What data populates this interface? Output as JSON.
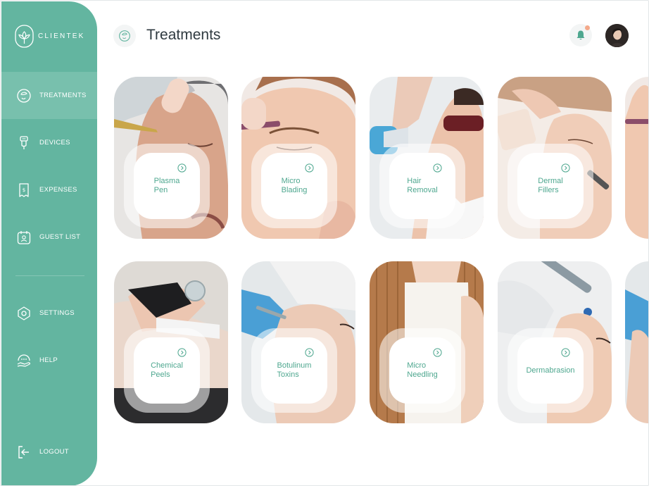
{
  "app": {
    "brand": "CLIENTEK"
  },
  "header": {
    "title": "Treatments"
  },
  "sidebar": {
    "items": [
      {
        "label": "TREATMENTS",
        "icon": "face-icon",
        "active": true
      },
      {
        "label": "DEVICES",
        "icon": "device-icon",
        "active": false
      },
      {
        "label": "EXPENSES",
        "icon": "receipt-icon",
        "active": false
      },
      {
        "label": "GUEST LIST",
        "icon": "calendar-user-icon",
        "active": false
      },
      {
        "label": "SETTINGS",
        "icon": "settings-icon",
        "active": false
      },
      {
        "label": "HELP",
        "icon": "help-hand-icon",
        "active": false
      },
      {
        "label": "LOGOUT",
        "icon": "logout-icon",
        "active": false
      }
    ]
  },
  "treatments": [
    {
      "label": "Plasma\nPen"
    },
    {
      "label": "Micro\nBlading"
    },
    {
      "label": "Hair\nRemoval"
    },
    {
      "label": "Dermal\nFillers"
    },
    {
      "label": "Chemical\nPeels"
    },
    {
      "label": "Botulinum\nToxins"
    },
    {
      "label": "Micro\nNeedling"
    },
    {
      "label": "Dermabrasion"
    }
  ],
  "colors": {
    "accent": "#63b5a0",
    "accent_active": "#78c0ad",
    "label": "#4ea78f",
    "notification": "#f4a98a"
  }
}
